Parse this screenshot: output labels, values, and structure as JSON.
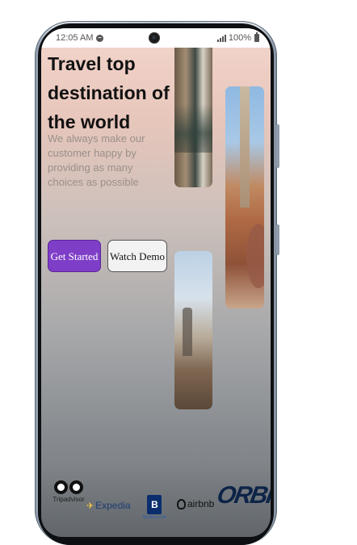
{
  "status_bar": {
    "time": "12:05 AM",
    "battery": "100%"
  },
  "hero": {
    "title": "Travel top destination of the world",
    "subtitle": "We always make our customer happy by providing as many choices as possible",
    "primary_button": "Get Started",
    "secondary_button": "Watch Demo"
  },
  "colors": {
    "primary": "#7f3ec8",
    "title": "#111111",
    "subtitle": "#9a8f8a"
  },
  "partners": {
    "tripadvisor": "Tripadvisor",
    "expedia": "Expedia",
    "booking": "B",
    "booking_sub": "Booking.com",
    "airbnb": "airbnb",
    "orbitz": "ORBITZ"
  },
  "icons": [
    "spotify-icon",
    "camera-icon",
    "signal-icon",
    "battery-icon",
    "owl-icon",
    "plane-icon",
    "booking-icon",
    "airbnb-icon"
  ]
}
